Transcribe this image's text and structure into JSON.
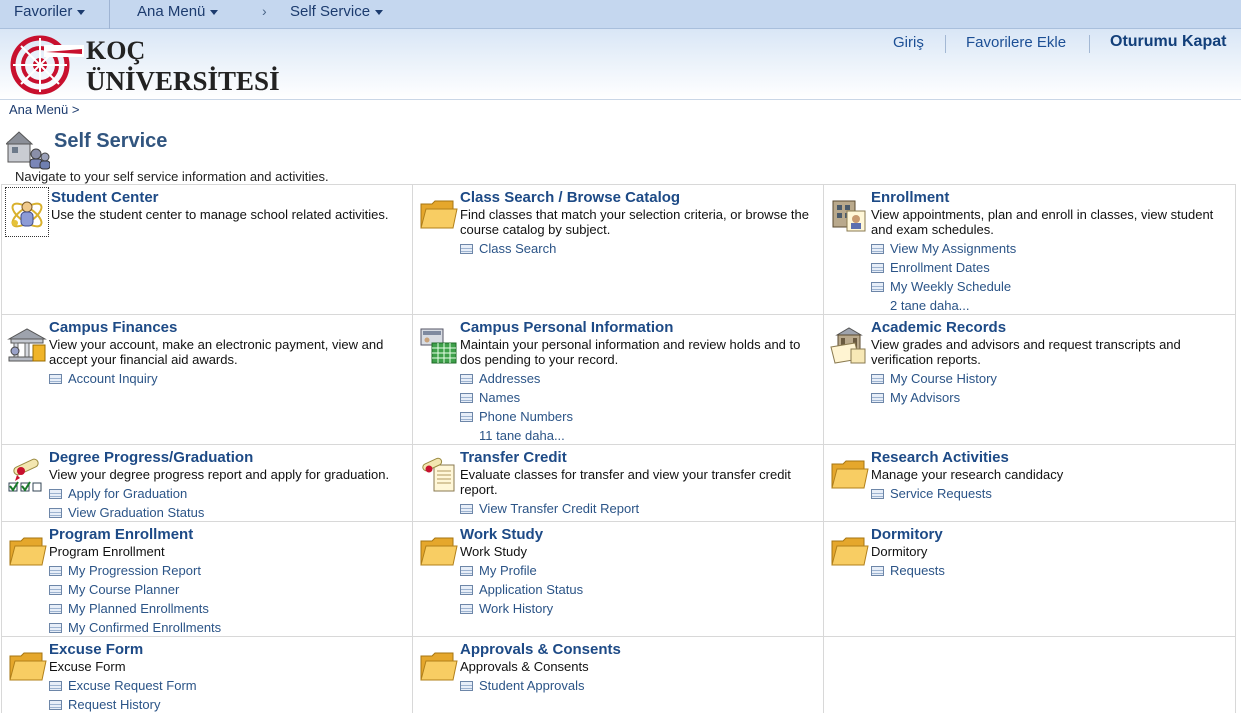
{
  "topnav": {
    "favorites": "Favoriler",
    "main_menu": "Ana Menü",
    "chevron": "›",
    "current": "Self Service"
  },
  "header": {
    "logo_line1": "KOÇ",
    "logo_line2": "ÜNİVERSİTESİ",
    "login": "Giriş",
    "add_favorites": "Favorilere Ekle",
    "logout": "Oturumu Kapat"
  },
  "breadcrumb": "Ana Menü >",
  "page": {
    "title": "Self Service",
    "description": "Navigate to your self service information and activities."
  },
  "colors": {
    "nav_bg": "#c5d7ef",
    "title_blue": "#1d4a86",
    "link_blue": "#2b5487",
    "logo_red": "#c8102e",
    "folder_yellow": "#f5c24d"
  },
  "tiles": [
    {
      "title": "Student Center",
      "icon": "student-center-icon",
      "desc": "Use the student center to manage school related activities.",
      "links": []
    },
    {
      "title": "Class Search / Browse Catalog",
      "icon": "folder-icon",
      "desc": "Find classes that match your selection criteria, or browse the course catalog by subject.",
      "links": [
        "Class Search"
      ]
    },
    {
      "title": "Enrollment",
      "icon": "enrollment-icon",
      "desc": "View appointments, plan and enroll in classes, view student and exam schedules.",
      "links": [
        "View My Assignments",
        "Enrollment Dates",
        "My Weekly Schedule"
      ],
      "more": "2 tane daha..."
    },
    {
      "title": "Campus Finances",
      "icon": "finances-icon",
      "desc": "View your account, make an electronic payment, view and accept your financial aid awards.",
      "links": [
        "Account Inquiry"
      ]
    },
    {
      "title": "Campus Personal Information",
      "icon": "personal-info-icon",
      "desc": "Maintain your personal information and review holds and to dos pending to your record.",
      "links": [
        "Addresses",
        "Names",
        "Phone Numbers"
      ],
      "more": "11 tane daha..."
    },
    {
      "title": "Academic Records",
      "icon": "academic-records-icon",
      "desc": "View grades and advisors and request transcripts and verification reports.",
      "links": [
        "My Course History",
        "My Advisors"
      ]
    },
    {
      "title": "Degree Progress/Graduation",
      "icon": "graduation-icon",
      "desc": "View your degree progress report and apply for graduation.",
      "links": [
        "Apply for Graduation",
        "View Graduation Status"
      ]
    },
    {
      "title": "Transfer Credit",
      "icon": "transfer-credit-icon",
      "desc": "Evaluate classes for transfer and view your transfer credit report.",
      "links": [
        "View Transfer Credit Report"
      ]
    },
    {
      "title": "Research Activities",
      "icon": "folder-icon",
      "desc": "Manage your research candidacy",
      "links": [
        "Service Requests"
      ]
    },
    {
      "title": "Program Enrollment",
      "icon": "folder-icon",
      "desc": "Program Enrollment",
      "links": [
        "My Progression Report",
        "My Course Planner",
        "My Planned Enrollments",
        "My Confirmed Enrollments"
      ]
    },
    {
      "title": "Work Study",
      "icon": "folder-icon",
      "desc": "Work Study",
      "links": [
        "My Profile",
        "Application Status",
        "Work History"
      ]
    },
    {
      "title": "Dormitory",
      "icon": "folder-icon",
      "desc": "Dormitory",
      "links": [
        "Requests"
      ]
    },
    {
      "title": "Excuse Form",
      "icon": "folder-icon",
      "desc": "Excuse Form",
      "links": [
        "Excuse Request Form",
        "Request History"
      ]
    },
    {
      "title": "Approvals & Consents",
      "icon": "folder-icon",
      "desc": "Approvals & Consents",
      "links": [
        "Student Approvals"
      ]
    }
  ]
}
